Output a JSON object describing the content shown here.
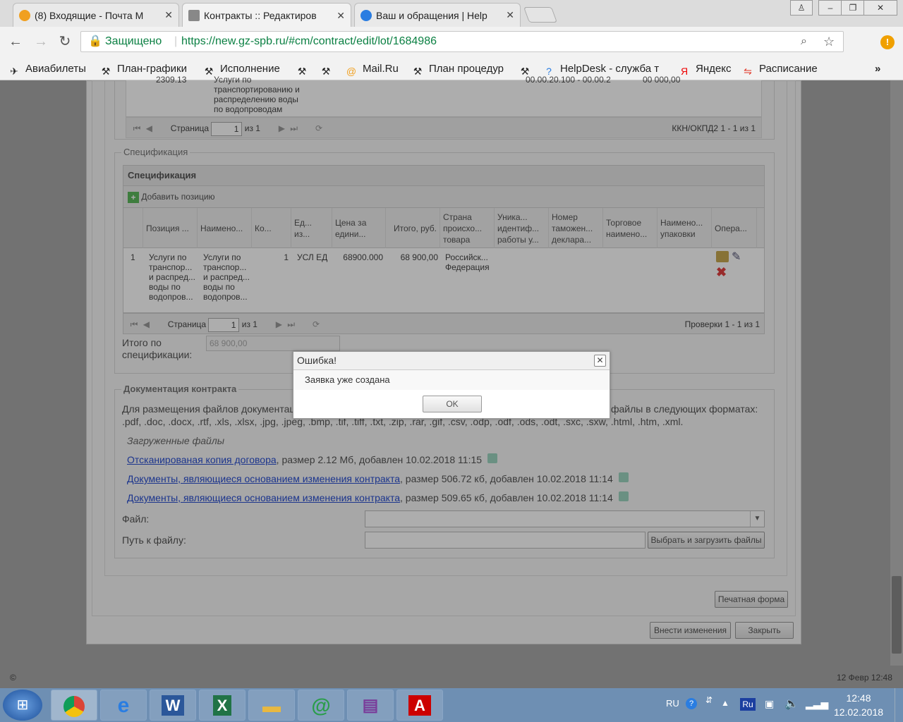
{
  "browser": {
    "tabs": [
      {
        "title": "(8) Входящие - Почта М",
        "active": false
      },
      {
        "title": "Контракты :: Редактиров",
        "active": true
      },
      {
        "title": "Ваш и обращения | Help",
        "active": false
      }
    ],
    "secure_label": "Защищено",
    "url": "https://new.gz-spb.ru/#cm/contract/edit/lot/1684986",
    "bookmarks": [
      "Авиабилеты",
      "План-графики",
      "Исполнение",
      "",
      "Mail.Ru",
      "План процедур",
      "",
      "HelpDesk - служба т",
      "Яндекс",
      "Расписание"
    ],
    "bookmarks_overflow": "»"
  },
  "top_grid": {
    "row_text_lines": [
      "2309.13",
      "Услуги по",
      "транспортированию и",
      "распределению воды",
      "по водопроводам"
    ],
    "row_cut_a": "00.00.20.100 - 00.00.2",
    "row_cut_b": "00 000,00",
    "pager": {
      "page_label": "Страница",
      "page": "1",
      "of": "из 1",
      "summary": "ККН/ОКПД2 1 - 1 из 1"
    }
  },
  "spec": {
    "legend": "Спецификация",
    "header": "Спецификация",
    "add_position": "Добавить позицию",
    "columns": [
      "Позиция ...",
      "Наимено...",
      "Ко...",
      "Ед... из...",
      "Цена за едини...",
      "Итого, руб.",
      "Страна происхо... товара",
      "Уника... идентиф... работы у...",
      "Номер таможен... деклара...",
      "Торговое наимено...",
      "Наимено... упаковки",
      "Опера..."
    ],
    "row": {
      "num": "1",
      "position": "Услуги по транспор... и распред... воды по водопров...",
      "name": "Услуги по транспор... и распред... воды по водопров...",
      "qty": "1",
      "unit": "УСЛ ЕД",
      "price": "68900.000",
      "total": "68 900,00",
      "country": "Российск... Федерация"
    },
    "pager": {
      "page_label": "Страница",
      "page": "1",
      "of": "из 1",
      "summary": "Проверки 1 - 1 из 1"
    },
    "total_label": "Итого по спецификации:",
    "total_value": "68 900,00"
  },
  "docs": {
    "legend": "Документация контракта",
    "intro": "Для размещения файлов документац",
    "intro_tail": "файлы в следующих форматах:",
    "formats": ".pdf, .doc, .docx, .rtf, .xls, .xlsx, .jpg, .jpeg, .bmp, .tif, .tiff, .txt, .zip, .rar, .gif, .csv, .odp, .odf, .ods, .odt, .sxc, .sxw, .html, .htm, .xml.",
    "uploaded_title": "Загруженные файлы",
    "files": [
      {
        "link": "Отсканированая копия договора",
        "info": ", размер 2.12 Мб, добавлен 10.02.2018 11:15"
      },
      {
        "link": "Документы, являющиеся основанием изменения контракта",
        "info": ", размер 506.72 кб, добавлен 10.02.2018 11:14"
      },
      {
        "link": "Документы, являющиеся основанием изменения контракта",
        "info": ", размер 509.65 кб, добавлен 10.02.2018 11:14"
      }
    ],
    "file_label": "Файл:",
    "path_label": "Путь к файлу:",
    "upload_button": "Выбрать и загрузить файлы"
  },
  "actions": {
    "print": "Печатная форма",
    "apply": "Внести изменения",
    "close": "Закрыть"
  },
  "footer": {
    "copyright": "©",
    "date": "12 Февр 12:48"
  },
  "dialog": {
    "title": "Ошибка!",
    "message": "Заявка уже создана",
    "ok": "OK"
  },
  "taskbar": {
    "lang": "RU",
    "ime": "Ru",
    "time": "12:48",
    "date": "12.02.2018"
  },
  "colors": {
    "accent_link": "#2a4fd0",
    "secure_green": "#0b8043",
    "error_x": "#e04040"
  }
}
